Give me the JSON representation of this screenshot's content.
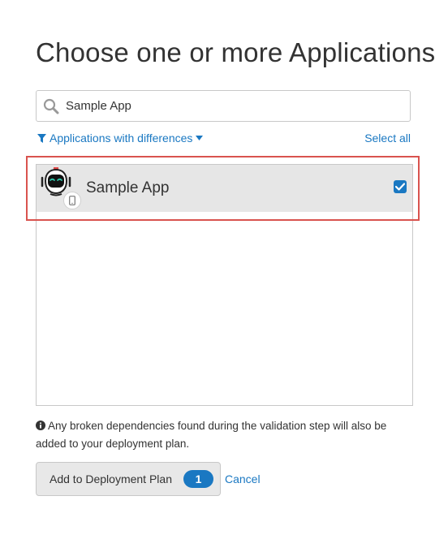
{
  "dialog": {
    "title": "Choose one or more Applications"
  },
  "search": {
    "value": "Sample App",
    "icon": "search-icon"
  },
  "filter": {
    "label": "Applications with differences"
  },
  "select_all_label": "Select all",
  "applications": [
    {
      "name": "Sample App",
      "selected": true,
      "platform_icon": "mobile-phone-icon"
    }
  ],
  "info": {
    "text": "Any broken dependencies found during the validation step will also be added to your deployment plan."
  },
  "actions": {
    "add_label": "Add to Deployment Plan",
    "selected_count": "1",
    "cancel_label": "Cancel"
  },
  "colors": {
    "accent": "#1a78c2",
    "highlight": "#d9534f",
    "row_bg": "#e6e6e6"
  }
}
